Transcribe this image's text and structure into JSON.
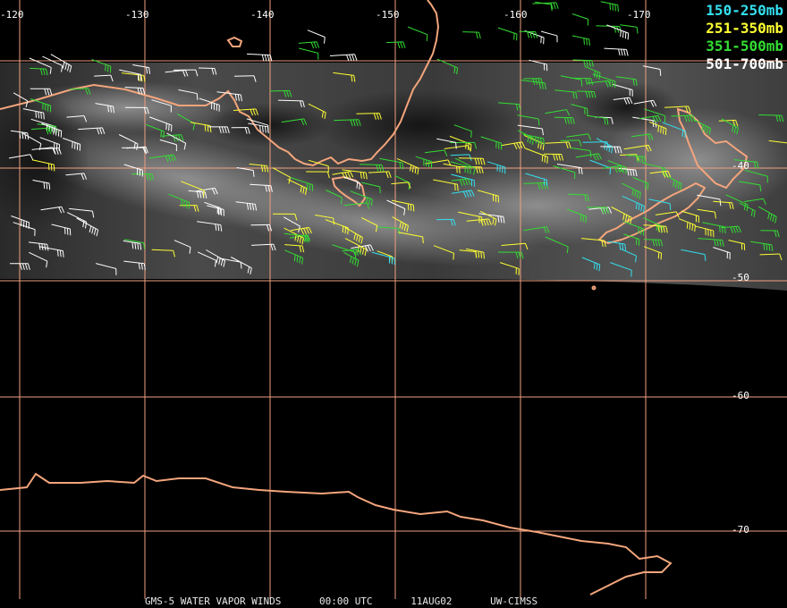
{
  "map": {
    "longitude_labels": [
      "-120",
      "-130",
      "-140",
      "-150",
      "-160",
      "-170"
    ],
    "latitude_labels": [
      "-40",
      "-50",
      "-60",
      "-70"
    ],
    "grid_color": "#f0a080",
    "coastline_color": "#f4a57c",
    "regions_shown": [
      "Australia (south coast)",
      "Tasmania",
      "New Zealand",
      "Antarctica (coast)"
    ]
  },
  "legend": {
    "items": [
      {
        "label": "150-250mb",
        "color": "#33e0f0"
      },
      {
        "label": "251-350mb",
        "color": "#ffff33"
      },
      {
        "label": "351-500mb",
        "color": "#33dd33"
      },
      {
        "label": "501-700mb",
        "color": "#ffffff"
      }
    ]
  },
  "footer": {
    "product": "GMS-5 WATER VAPOR WINDS",
    "time": "00:00 UTC",
    "date": "11AUG02",
    "source": "UW-CIMSS"
  }
}
